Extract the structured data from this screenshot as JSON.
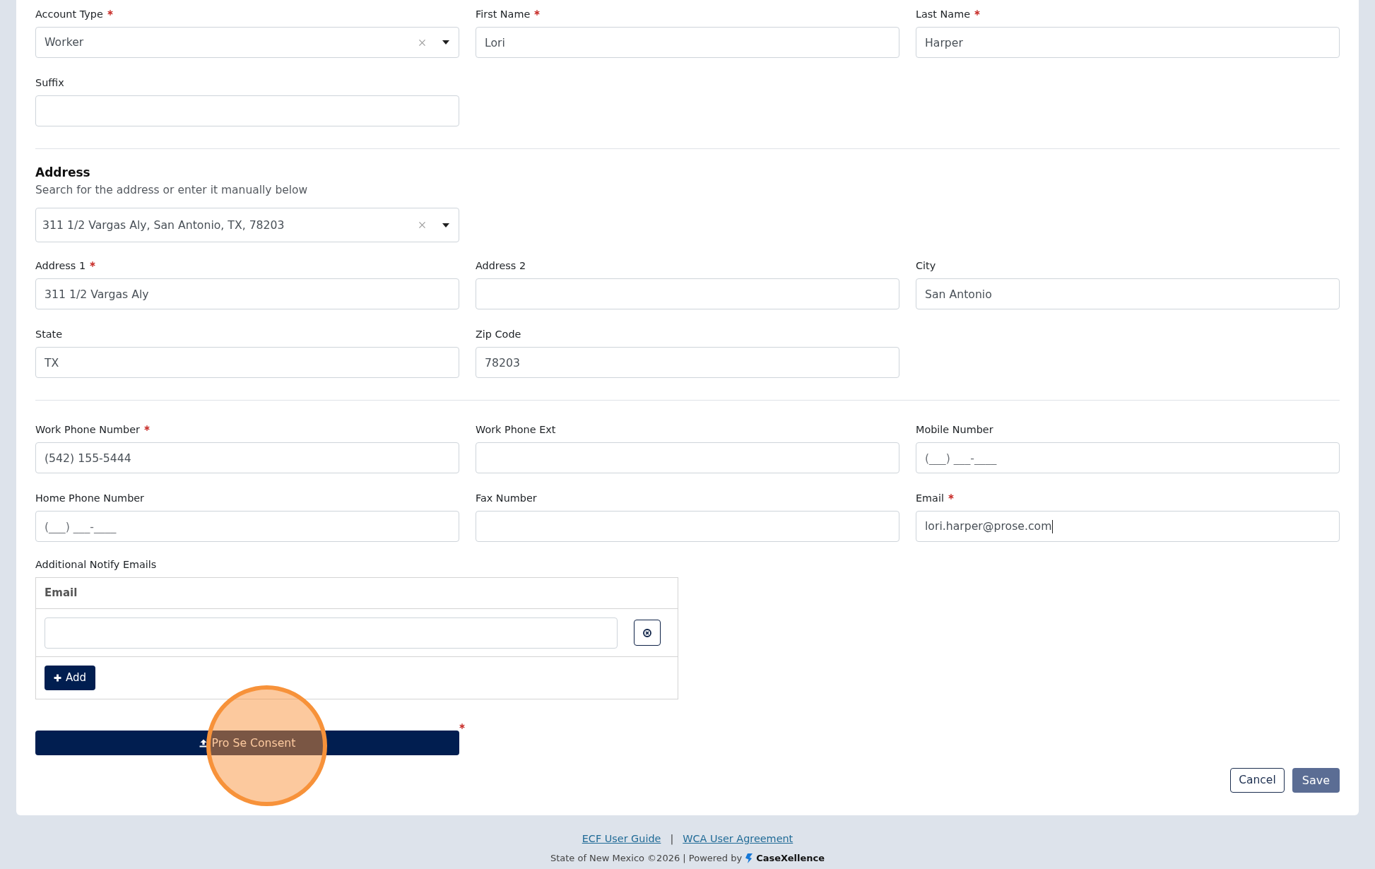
{
  "personal": {
    "fields": [
      {
        "kind": "select",
        "label": "Account Type",
        "required": true,
        "value": "Worker"
      },
      {
        "kind": "text",
        "label": "First Name",
        "required": true,
        "value": "Lori"
      },
      {
        "kind": "text",
        "label": "Last Name",
        "required": true,
        "value": "Harper"
      },
      {
        "kind": "text",
        "label": "Suffix",
        "required": false
      }
    ]
  },
  "address": {
    "heading": "Address",
    "hint": "Search for the address or enter it manually below",
    "search": {
      "value": "311 1/2 Vargas Aly, San Antonio, TX, 78203"
    },
    "fields": [
      {
        "label": "Address 1",
        "required": true,
        "value": "311 1/2 Vargas Aly"
      },
      {
        "label": "Address 2",
        "required": false
      },
      {
        "label": "City",
        "required": false,
        "value": "San Antonio"
      },
      {
        "label": "State",
        "required": false,
        "value": "TX"
      },
      {
        "label": "Zip Code",
        "required": false,
        "value": "78203"
      }
    ]
  },
  "contact": {
    "fields": [
      {
        "label": "Work Phone Number",
        "required": true,
        "focused": false,
        "value": "(542) 155-5444"
      },
      {
        "label": "Work Phone Ext",
        "required": false,
        "focused": false
      },
      {
        "label": "Mobile Number",
        "required": false,
        "focused": false,
        "placeholder": "(___) ___-____"
      },
      {
        "label": "Home Phone Number",
        "required": false,
        "focused": false,
        "placeholder": "(___) ___-____"
      },
      {
        "label": "Fax Number",
        "required": false,
        "focused": false
      },
      {
        "label": "Email",
        "required": true,
        "focused": true,
        "value": "lori.harper@prose.com"
      }
    ]
  },
  "notify_emails": {
    "label": "Additional Notify Emails",
    "columns": [
      "Email"
    ],
    "rows": [
      {
        "removable": true
      }
    ],
    "add_button": "Add"
  },
  "consent": {
    "label": "Pro Se Consent",
    "required": true
  },
  "actions": [
    {
      "kind": "secondary",
      "label": "Cancel",
      "disabled": false
    },
    {
      "kind": "primary",
      "label": "Save",
      "disabled": true
    }
  ],
  "footer": {
    "links": [
      "ECF User Guide",
      "WCA User Agreement"
    ],
    "separator": "|",
    "copyright": "State of New Mexico ©2026 | Powered by",
    "brand": "CaseXellence"
  }
}
